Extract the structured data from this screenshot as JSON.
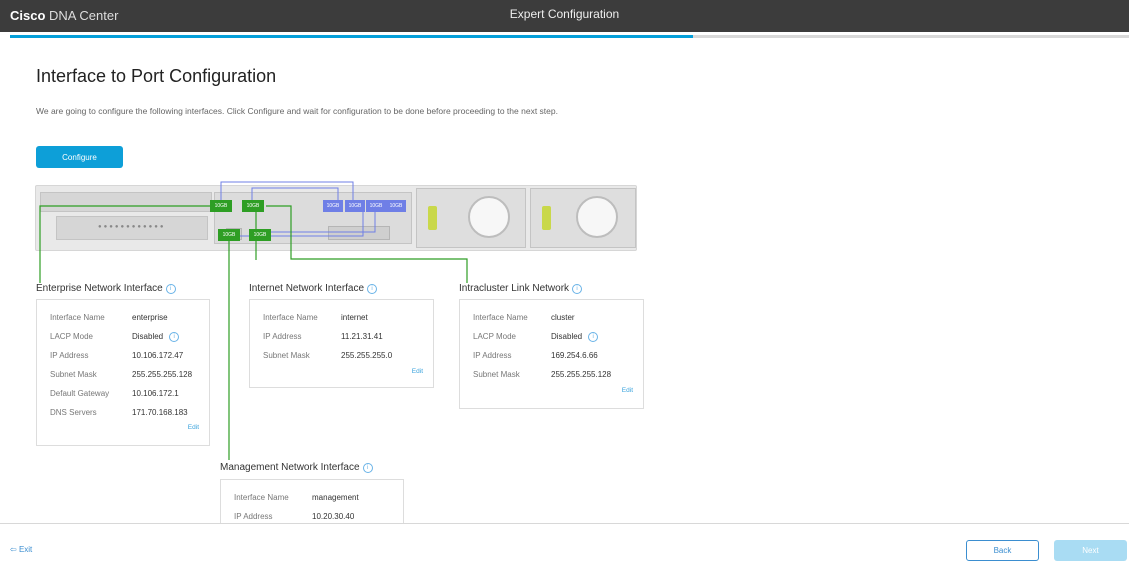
{
  "header": {
    "brand_bold": "Cisco",
    "brand_rest": "DNA Center",
    "title": "Expert Configuration"
  },
  "progress": {
    "fraction": 0.61
  },
  "main": {
    "title": "Interface to Port Configuration",
    "description": "We are going to configure the following interfaces. Click Configure and wait for configuration to be done before proceeding to the next step.",
    "configure_label": "Configure"
  },
  "ports": {
    "label": "10GB"
  },
  "enterprise": {
    "title": "Enterprise Network Interface",
    "rows": [
      {
        "k": "Interface Name",
        "v": "enterprise"
      },
      {
        "k": "LACP Mode",
        "v": "Disabled"
      },
      {
        "k": "IP Address",
        "v": "10.106.172.47"
      },
      {
        "k": "Subnet Mask",
        "v": "255.255.255.128"
      },
      {
        "k": "Default Gateway",
        "v": "10.106.172.1"
      },
      {
        "k": "DNS Servers",
        "v": "171.70.168.183"
      }
    ],
    "edit": "Edit"
  },
  "internet": {
    "title": "Internet Network Interface",
    "rows": [
      {
        "k": "Interface Name",
        "v": "internet"
      },
      {
        "k": "IP Address",
        "v": "11.21.31.41"
      },
      {
        "k": "Subnet Mask",
        "v": "255.255.255.0"
      }
    ],
    "edit": "Edit"
  },
  "cluster": {
    "title": "Intracluster Link Network",
    "rows": [
      {
        "k": "Interface Name",
        "v": "cluster"
      },
      {
        "k": "LACP Mode",
        "v": "Disabled"
      },
      {
        "k": "IP Address",
        "v": "169.254.6.66"
      },
      {
        "k": "Subnet Mask",
        "v": "255.255.255.128"
      }
    ],
    "edit": "Edit"
  },
  "management": {
    "title": "Management Network Interface",
    "rows": [
      {
        "k": "Interface Name",
        "v": "management"
      },
      {
        "k": "IP Address",
        "v": "10.20.30.40"
      }
    ]
  },
  "footer": {
    "exit": "Exit",
    "back": "Back",
    "next": "Next"
  },
  "colors": {
    "accent": "#049fd9",
    "port_green": "#2e9e24",
    "port_blue": "#6f7fe6"
  }
}
